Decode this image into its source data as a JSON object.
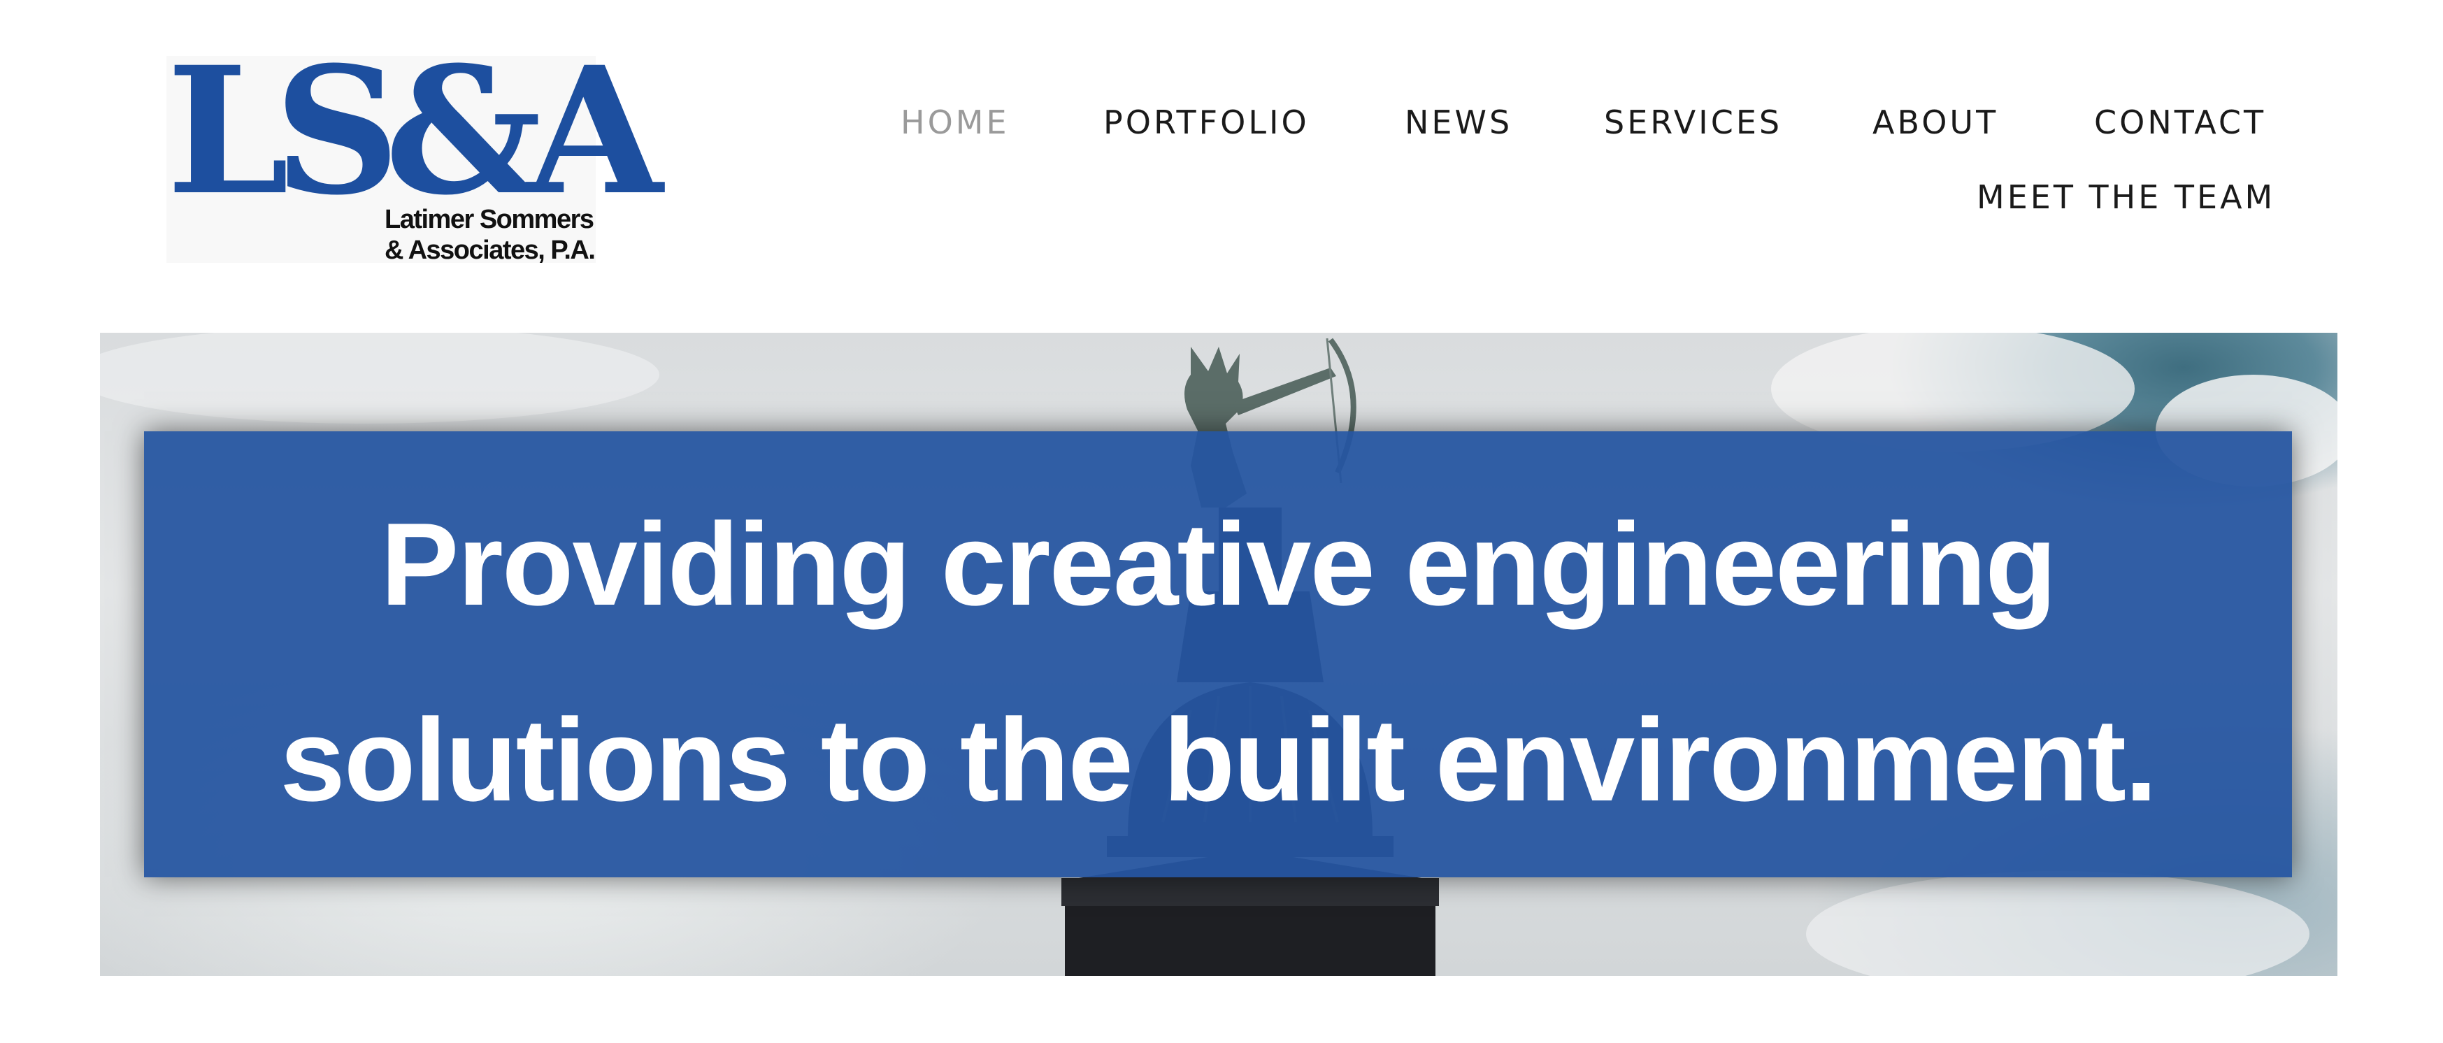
{
  "colors": {
    "brand_blue": "#1d4f9f",
    "nav_text": "#1a1a1a",
    "nav_active": "#9a9a9a",
    "banner_blue": "#2555a0",
    "banner_text": "#ffffff"
  },
  "logo": {
    "mark": "LS&A",
    "name_line1": "Latimer Sommers",
    "name_line2": "& Associates, P.A."
  },
  "nav": {
    "active": "HOME",
    "items": [
      "HOME",
      "PORTFOLIO",
      "NEWS",
      "SERVICES",
      "ABOUT",
      "CONTACT",
      "MEET THE TEAM"
    ]
  },
  "hero": {
    "tagline_line1": "Providing creative engineering",
    "tagline_line2": "solutions to the built environment."
  }
}
